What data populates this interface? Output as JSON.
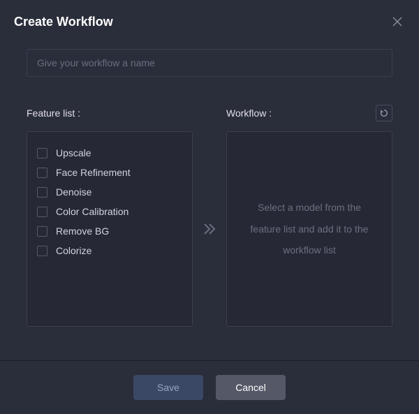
{
  "dialog": {
    "title": "Create Workflow"
  },
  "nameInput": {
    "placeholder": "Give your workflow a name",
    "value": ""
  },
  "labels": {
    "featureList": "Feature list :",
    "workflow": "Workflow :"
  },
  "features": [
    {
      "label": "Upscale"
    },
    {
      "label": "Face Refinement"
    },
    {
      "label": "Denoise"
    },
    {
      "label": "Color Calibration"
    },
    {
      "label": "Remove BG"
    },
    {
      "label": "Colorize"
    }
  ],
  "workflowPanel": {
    "emptyText": "Select a model from the feature list and add it to the workflow list"
  },
  "buttons": {
    "save": "Save",
    "cancel": "Cancel"
  }
}
